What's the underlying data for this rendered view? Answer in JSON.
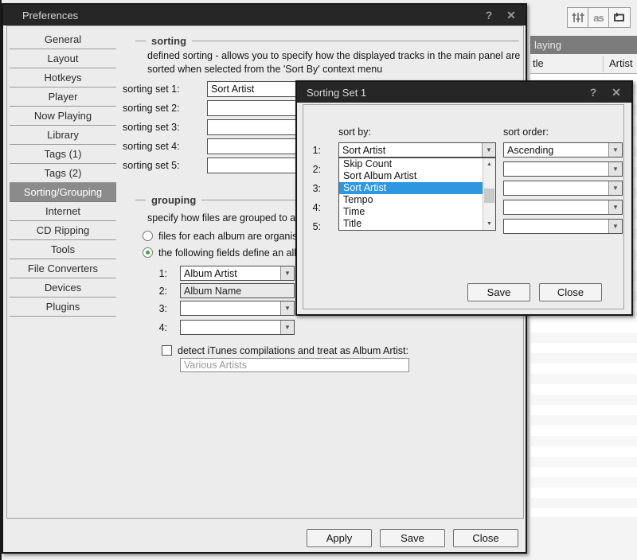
{
  "colors": {
    "titlebar": "#262626",
    "selection_blue": "#2f96e0",
    "radio_green": "#3da93f",
    "sidebar_selected": "#8b8b8b"
  },
  "background": {
    "toolbar": {
      "lastfm_label": "as"
    },
    "now_playing_partial": "laying",
    "columns": {
      "title_partial": "tle",
      "artist": "Artist"
    }
  },
  "preferences": {
    "title": "Preferences",
    "help_button": "?",
    "close_button": "✕",
    "sidebar": [
      "General",
      "Layout",
      "Hotkeys",
      "Player",
      "Now Playing",
      "Library",
      "Tags (1)",
      "Tags (2)",
      "Sorting/Grouping",
      "Internet",
      "CD Ripping",
      "Tools",
      "File Converters",
      "Devices",
      "Plugins"
    ],
    "sorting": {
      "header": "sorting",
      "description_line1": "defined sorting - allows you to specify how the displayed tracks in the main panel are",
      "description_line2": "sorted when selected from the 'Sort By' context menu",
      "rows": [
        {
          "label": "sorting set 1:",
          "value": "Sort Artist"
        },
        {
          "label": "sorting set 2:",
          "value": ""
        },
        {
          "label": "sorting set 3:",
          "value": ""
        },
        {
          "label": "sorting set 4:",
          "value": ""
        },
        {
          "label": "sorting set 5:",
          "value": ""
        }
      ]
    },
    "grouping": {
      "header": "grouping",
      "description_partial": "specify how files are grouped to an a",
      "radio_option1_partial": "files for each album are organised",
      "radio_option2_partial": "the following fields define an albu",
      "fields": [
        {
          "label": "1:",
          "value": "Album Artist"
        },
        {
          "label": "2:",
          "value": "Album Name"
        },
        {
          "label": "3:",
          "value": ""
        },
        {
          "label": "4:",
          "value": ""
        }
      ],
      "checkbox_label": "detect iTunes compilations and treat as Album Artist:",
      "compilation_value": "Various Artists"
    },
    "buttons": {
      "apply": "Apply",
      "save": "Save",
      "close": "Close"
    }
  },
  "sorting_set_dialog": {
    "title": "Sorting Set 1",
    "help_button": "?",
    "close_button": "✕",
    "sort_by_label": "sort by:",
    "sort_order_label": "sort order:",
    "row_numbers": [
      "1:",
      "2:",
      "3:",
      "4:",
      "5:"
    ],
    "sort_by_value": "Sort Artist",
    "sort_order_value": "Ascending",
    "dropdown_items": [
      "Skip Count",
      "Sort Album Artist",
      "Sort Artist",
      "Tempo",
      "Time",
      "Title"
    ],
    "selected_dropdown_item": "Sort Artist",
    "buttons": {
      "save": "Save",
      "close": "Close"
    }
  }
}
